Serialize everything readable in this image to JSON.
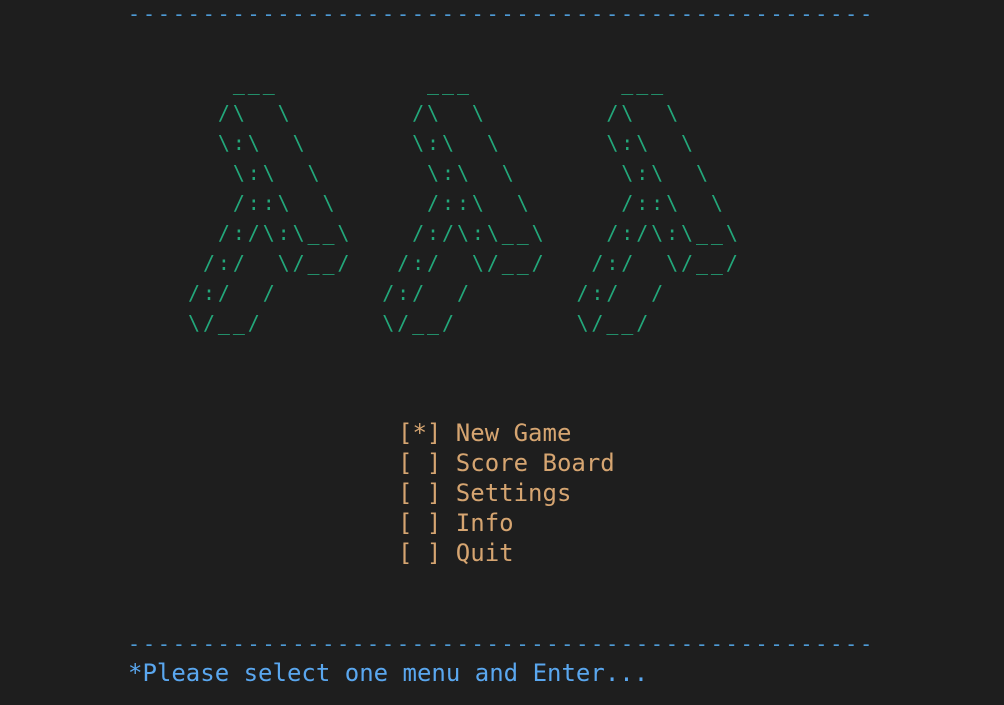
{
  "rule": "--------------------------------------------------",
  "logo_art": "   ___          ___          ___\n  /\\  \\        /\\  \\        /\\  \\\n  \\:\\  \\       \\:\\  \\       \\:\\  \\\n   \\:\\  \\       \\:\\  \\       \\:\\  \\\n   /::\\  \\      /::\\  \\      /::\\  \\\n  /:/\\:\\__\\    /:/\\:\\__\\    /:/\\:\\__\\\n /:/  \\/__/   /:/  \\/__/   /:/  \\/__/\n/:/  /       /:/  /       /:/  /\n\\/__/        \\/__/        \\/__/",
  "menu": {
    "items": [
      {
        "label": "[*] New Game"
      },
      {
        "label": "[ ] Score Board"
      },
      {
        "label": "[ ] Settings"
      },
      {
        "label": "[ ] Info"
      },
      {
        "label": "[ ] Quit"
      }
    ]
  },
  "prompt": "*Please select one menu and Enter...",
  "colors": {
    "background": "#1e1e1e",
    "rule": "#4e9bd6",
    "logo": "#23a77a",
    "menu": "#d6a571",
    "prompt": "#5aa7ef"
  }
}
